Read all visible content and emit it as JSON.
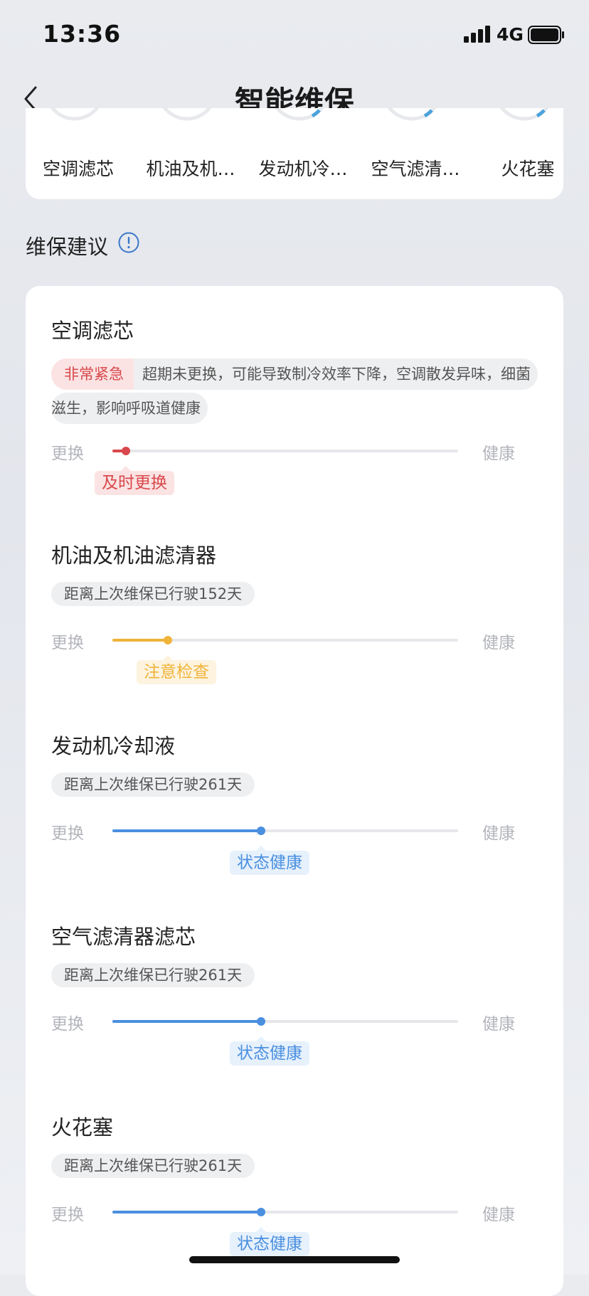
{
  "status_bar": {
    "time": "13:36",
    "network": "4G"
  },
  "nav": {
    "title": "智能维保"
  },
  "top_items": [
    {
      "label": "空调滤芯"
    },
    {
      "label": "机油及机…"
    },
    {
      "label": "发动机冷…"
    },
    {
      "label": "空气滤清…"
    },
    {
      "label": "火花塞"
    }
  ],
  "section": {
    "title": "维保建议"
  },
  "scale": {
    "left_label": "更换",
    "right_label": "健康"
  },
  "items": [
    {
      "name": "空调滤芯",
      "tag": "非常紧急",
      "description": "超期未更换，可能导致制冷效率下降，空调散发异味，细菌滋生，影响呼吸道健康",
      "status": "及时更换",
      "level": 0.04,
      "color": "#d9484c",
      "badge_bg": "#fbe3e3"
    },
    {
      "name": "机油及机油滤清器",
      "description": "距离上次维保已行驶152天",
      "status": "注意检查",
      "level": 0.16,
      "color": "#f0b43a",
      "badge_bg": "#fdf3df"
    },
    {
      "name": "发动机冷却液",
      "description": "距离上次维保已行驶261天",
      "status": "状态健康",
      "level": 0.43,
      "color": "#4a8fe0",
      "badge_bg": "#e6f1fc"
    },
    {
      "name": "空气滤清器滤芯",
      "description": "距离上次维保已行驶261天",
      "status": "状态健康",
      "level": 0.43,
      "color": "#4a8fe0",
      "badge_bg": "#e6f1fc"
    },
    {
      "name": "火花塞",
      "description": "距离上次维保已行驶261天",
      "status": "状态健康",
      "level": 0.43,
      "color": "#4a8fe0",
      "badge_bg": "#e6f1fc"
    }
  ]
}
